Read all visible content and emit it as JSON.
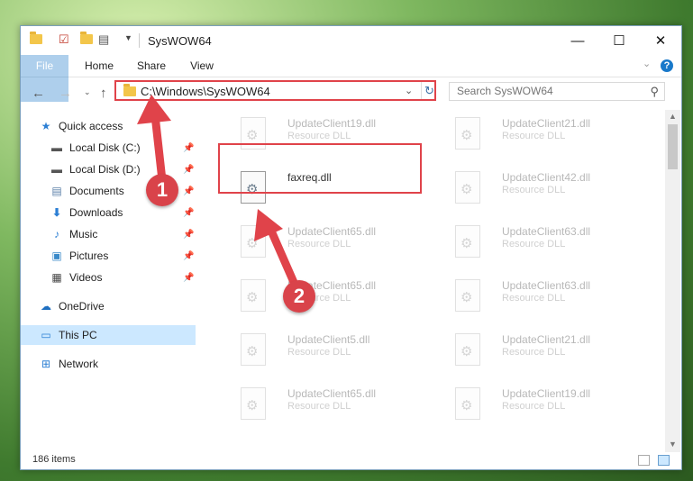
{
  "window": {
    "title": "SysWOW64",
    "tabs": [
      "File",
      "Home",
      "Share",
      "View"
    ],
    "help_label": "?"
  },
  "address": {
    "path": "C:\\Windows\\SysWOW64",
    "search_placeholder": "Search SysWOW64"
  },
  "nav": {
    "items": [
      {
        "label": "Quick access",
        "icon": "star-icon",
        "pinned": false
      },
      {
        "label": "Local Disk (C:)",
        "icon": "drive-icon",
        "pinned": true
      },
      {
        "label": "Local Disk (D:)",
        "icon": "drive-icon",
        "pinned": true
      },
      {
        "label": "Documents",
        "icon": "documents-icon",
        "pinned": true
      },
      {
        "label": "Downloads",
        "icon": "download-icon",
        "pinned": true
      },
      {
        "label": "Music",
        "icon": "music-icon",
        "pinned": true
      },
      {
        "label": "Pictures",
        "icon": "pictures-icon",
        "pinned": true
      },
      {
        "label": "Videos",
        "icon": "videos-icon",
        "pinned": true
      },
      {
        "label": "OneDrive",
        "icon": "cloud-icon",
        "pinned": false
      },
      {
        "label": "This PC",
        "icon": "computer-icon",
        "pinned": false,
        "selected": true
      },
      {
        "label": "Network",
        "icon": "network-icon",
        "pinned": false
      }
    ]
  },
  "files": [
    {
      "name": "UpdateClient19.dll",
      "type": "Resource DLL"
    },
    {
      "name": "UpdateClient21.dll",
      "type": "Resource DLL"
    },
    {
      "name": "faxreq.dll",
      "type": ""
    },
    {
      "name": "UpdateClient42.dll",
      "type": "Resource DLL"
    },
    {
      "name": "UpdateClient65.dll",
      "type": "Resource DLL"
    },
    {
      "name": "UpdateClient63.dll",
      "type": "Resource DLL"
    },
    {
      "name": "UpdateClient65.dll",
      "type": "Resource DLL"
    },
    {
      "name": "UpdateClient63.dll",
      "type": "Resource DLL"
    },
    {
      "name": "UpdateClient5.dll",
      "type": "Resource DLL"
    },
    {
      "name": "UpdateClient21.dll",
      "type": "Resource DLL"
    },
    {
      "name": "UpdateClient65.dll",
      "type": "Resource DLL"
    },
    {
      "name": "UpdateClient19.dll",
      "type": "Resource DLL"
    }
  ],
  "status": {
    "item_count": "186 items"
  },
  "annotations": {
    "step1": "1",
    "step2": "2",
    "color": "#e0434a"
  }
}
